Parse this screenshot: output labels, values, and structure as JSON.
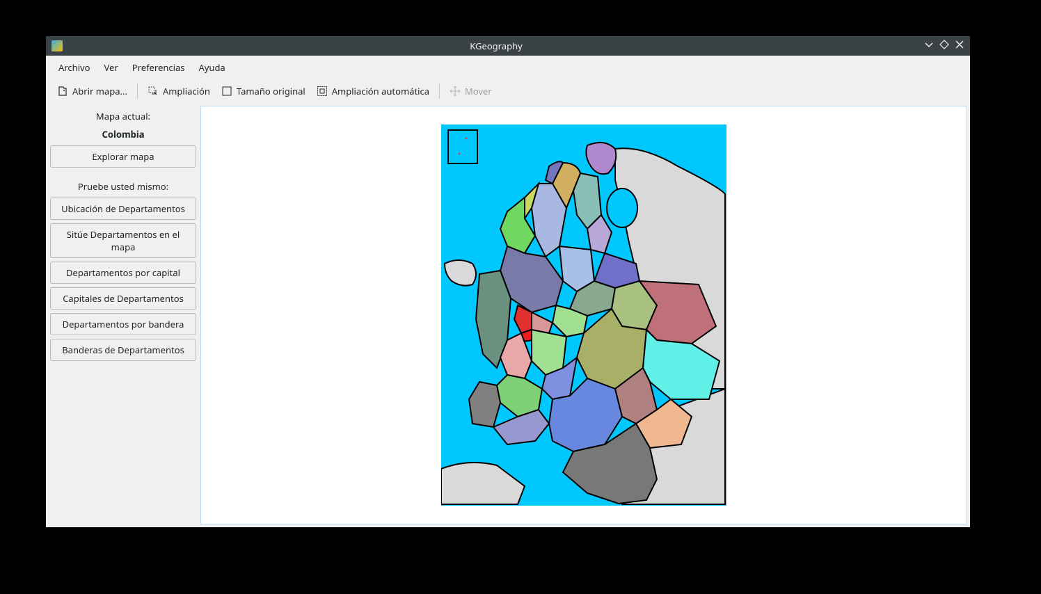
{
  "titlebar": {
    "title": "KGeography"
  },
  "menubar": {
    "file": "Archivo",
    "view": "Ver",
    "preferences": "Preferencias",
    "help": "Ayuda"
  },
  "toolbar": {
    "open_map": "Abrir mapa...",
    "zoom": "Ampliación",
    "original_size": "Tamaño original",
    "auto_zoom": "Ampliación automática",
    "move": "Mover"
  },
  "sidebar": {
    "current_map_label": "Mapa actual:",
    "current_map_name": "Colombia",
    "explore": "Explorar mapa",
    "test_yourself": "Pruebe usted mismo:",
    "buttons": [
      "Ubicación de Departamentos",
      "Sitúe Departamentos en el mapa",
      "Departamentos por capital",
      "Capitales de Departamentos",
      "Departamentos por bandera",
      "Banderas de Departamentos"
    ]
  }
}
